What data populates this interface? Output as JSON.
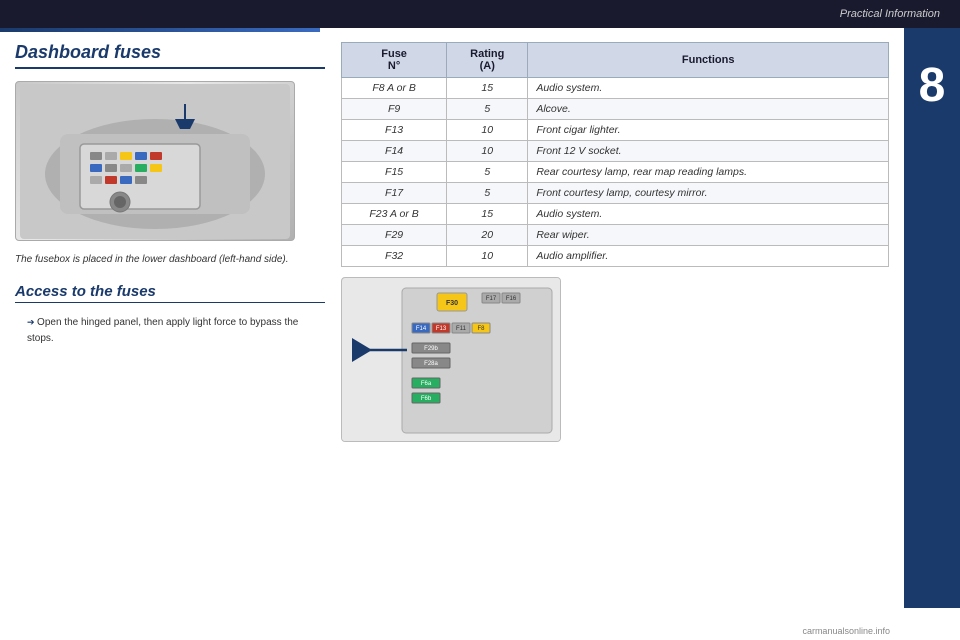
{
  "topBar": {
    "title": "Practical Information"
  },
  "leftCol": {
    "sectionTitle": "Dashboard fuses",
    "imageCaption": "The fusebox is placed in the lower dashboard (left-hand side).",
    "accessTitle": "Access to the fuses",
    "accessSteps": [
      "Open the hinged panel, then apply light force to bypass the stops."
    ]
  },
  "table": {
    "headers": [
      "Fuse N°",
      "Rating (A)",
      "Functions"
    ],
    "rows": [
      {
        "fuse": "F8 A or B",
        "rating": "15",
        "function": "Audio system."
      },
      {
        "fuse": "F9",
        "rating": "5",
        "function": "Alcove."
      },
      {
        "fuse": "F13",
        "rating": "10",
        "function": "Front cigar lighter."
      },
      {
        "fuse": "F14",
        "rating": "10",
        "function": "Front 12 V socket."
      },
      {
        "fuse": "F15",
        "rating": "5",
        "function": "Rear courtesy lamp, rear map reading lamps."
      },
      {
        "fuse": "F17",
        "rating": "5",
        "function": "Front courtesy lamp, courtesy mirror."
      },
      {
        "fuse": "F23 A or B",
        "rating": "15",
        "function": "Audio system."
      },
      {
        "fuse": "F29",
        "rating": "20",
        "function": "Rear wiper."
      },
      {
        "fuse": "F32",
        "rating": "10",
        "function": "Audio amplifier."
      }
    ]
  },
  "sectionNumber": "8",
  "watermark": "carmanualsonline.info",
  "diagramLabels": {
    "f30": "F30",
    "f17": "F17",
    "f16": "F16",
    "f14": "F14",
    "f13": "F13",
    "f11": "F11",
    "f8": "F8",
    "f29b": "F29b",
    "f28a": "F28a",
    "f6a": "F6a",
    "f6b": "F6b"
  }
}
